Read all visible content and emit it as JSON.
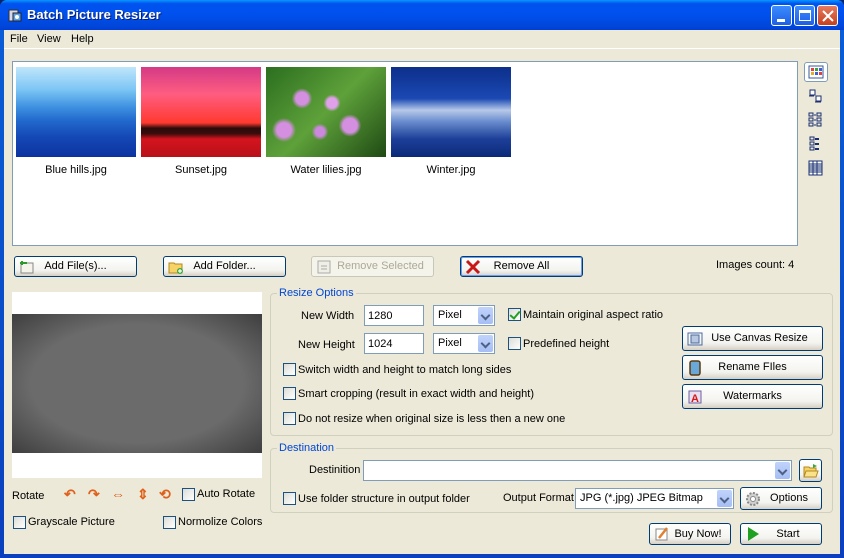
{
  "window": {
    "title": "Batch Picture Resizer",
    "minimize": "minimize",
    "maximize": "maximize",
    "close": "close"
  },
  "menu": [
    "File",
    "View",
    "Help"
  ],
  "thumbnails": [
    {
      "name": "Blue hills.jpg",
      "colors": [
        "#bfe6fb",
        "#4ea8ea",
        "#1a5fc4",
        "#0b33a0"
      ]
    },
    {
      "name": "Sunset.jpg",
      "colors": [
        "#e8467a",
        "#ff4b6b",
        "#ff2a20",
        "#2a0c0a",
        "#c9141e"
      ]
    },
    {
      "name": "Water lilies.jpg",
      "colors": [
        "#2b6e1f",
        "#5ea13a",
        "#d58fe0",
        "#0f2a0b"
      ]
    },
    {
      "name": "Winter.jpg",
      "colors": [
        "#0c2f8a",
        "#1b49b3",
        "#b7c9e9",
        "#0a2a78"
      ]
    }
  ],
  "view_buttons": [
    "thumbnails-view",
    "icons-view",
    "list-view",
    "small-list-view",
    "details-view"
  ],
  "buttons": {
    "add_files": "Add File(s)...",
    "add_folder": "Add Folder...",
    "remove_selected": "Remove Selected",
    "remove_all": "Remove All"
  },
  "images_count": "Images count: 4",
  "preview": {
    "rotate_label": "Rotate",
    "auto_rotate": "Auto Rotate",
    "auto_rotate_checked": false,
    "grayscale": "Grayscale Picture",
    "grayscale_checked": false,
    "normalize": "Normolize Colors",
    "normalize_checked": false
  },
  "resize": {
    "title": "Resize Options",
    "width_label": "New Width",
    "width_value": "1280",
    "width_unit": "Pixel",
    "height_label": "New Height",
    "height_value": "1024",
    "height_unit": "Pixel",
    "maintain_aspect": "Maintain original aspect ratio",
    "maintain_aspect_checked": true,
    "predefined_height": "Predefined height",
    "predefined_height_checked": false,
    "switch_sides": "Switch width and height to match long sides",
    "switch_sides_checked": false,
    "smart_crop": "Smart cropping (result in exact width and height)",
    "smart_crop_checked": false,
    "no_upscale": "Do not resize when original size is less then a new one",
    "no_upscale_checked": false
  },
  "side_buttons": {
    "canvas": "Use Canvas Resize",
    "rename": "Rename FIles",
    "watermarks": "Watermarks"
  },
  "destination": {
    "title": "Destination",
    "label": "Destinition",
    "value": "",
    "folder_structure": "Use folder structure in output folder",
    "folder_structure_checked": false,
    "format_label": "Output Format",
    "format_value": "JPG (*.jpg) JPEG Bitmap",
    "options": "Options"
  },
  "footer": {
    "buy": "Buy Now!",
    "start": "Start"
  }
}
